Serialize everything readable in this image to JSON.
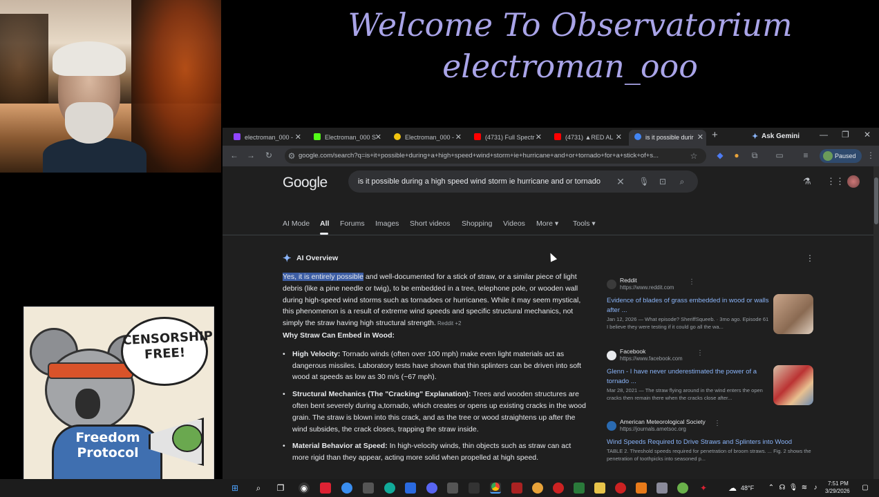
{
  "banner": {
    "line1": "Welcome To Observatorium",
    "line2": "electroman_ooo"
  },
  "sticker": {
    "bubble": "CENSORSHIP FREE!",
    "hoodie": "Freedom Protocol"
  },
  "browser": {
    "tabs": [
      {
        "label": "electroman_000 -",
        "color": "#9146ff"
      },
      {
        "label": "Electroman_000 S",
        "color": "#53fc18"
      },
      {
        "label": "Electroman_000 -",
        "color": "#f1c40f"
      },
      {
        "label": "(4731) Full Spectr",
        "color": "#ff0000"
      },
      {
        "label": "(4731) ▲RED AL",
        "color": "#ff0000"
      },
      {
        "label": "is it possible durir",
        "color": "#4285f4"
      }
    ],
    "ask_gemini": "Ask Gemini",
    "url": "google.com/search?q=is+it+possible+during+a+high+speed+wind+storm+ie+hurricane+and+or+tornado+for+a+stick+of+s...",
    "paused": "Paused"
  },
  "google": {
    "logo": "Google",
    "query": "is it possible during a high speed wind storm ie hurricane and or tornado",
    "nav": [
      "AI Mode",
      "All",
      "Forums",
      "Images",
      "Short videos",
      "Shopping",
      "Videos",
      "More ▾",
      "Tools ▾"
    ],
    "ai_overview_label": "AI Overview",
    "intro_highlight": "Yes, it is entirely possible",
    "intro_rest": " and well-documented for a stick of straw, or a similar piece of light debris (like a pine needle or twig), to be embedded in a tree, telephone pole, or wooden wall during high-speed wind storms such as tornadoes or hurricanes. While it may seem mystical, this phenomenon is a result of extreme wind speeds and specific structural mechanics, not simply the straw having high structural strength.",
    "intro_cite": " Reddit +2",
    "subheading": "Why Straw Can Embed in Wood:",
    "bullets": [
      {
        "title": "High Velocity:",
        "text": " Tornado winds (often over 100 mph) make even light materials act as dangerous missiles. Laboratory tests have shown that thin splinters can be driven into soft wood at speeds as low as 30 m/s (~67 mph)."
      },
      {
        "title": "Structural Mechanics (The \"Cracking\" Explanation):",
        "text": " Trees and wooden structures are often bent severely during a,tornado, which creates or opens up existing cracks in the wood grain. The straw is blown into this crack, and as the tree or wood straightens up after the wind subsides, the crack closes, trapping the straw inside."
      },
      {
        "title": "Material Behavior at Speed:",
        "text": " In high-velocity winds, thin objects such as straw can act more rigid than they appear, acting more solid when propelled at high speed."
      }
    ],
    "sources": [
      {
        "name": "Reddit",
        "url": "https://www.reddit.com",
        "title": "Evidence of blades of grass embedded in wood or walls after ...",
        "snippet": "Jan 12, 2026 — What episode? SheriffSqueeb. · 3mo ago. Episode 61 I believe they were testing if it could go all the wa..."
      },
      {
        "name": "Facebook",
        "url": "https://www.facebook.com",
        "title": "Glenn - I have never underestimated the power of a tornado ...",
        "snippet": "Mar 28, 2021 — The straw flying around in the wind enters the open cracks then remain there when the cracks close after..."
      },
      {
        "name": "American Meteorological Society",
        "url": "https://journals.ametsoc.org",
        "title": "Wind Speeds Required to Drive Straws and Splinters into Wood",
        "snippet": "TABLE 2. Threshold speeds required for penetration of broom straws. ... Fig. 2 shows the penetration of toothpicks into seasoned p..."
      }
    ]
  },
  "taskbar": {
    "temperature": "48°F",
    "time": "7:51 PM",
    "date": "3/29/2026"
  }
}
